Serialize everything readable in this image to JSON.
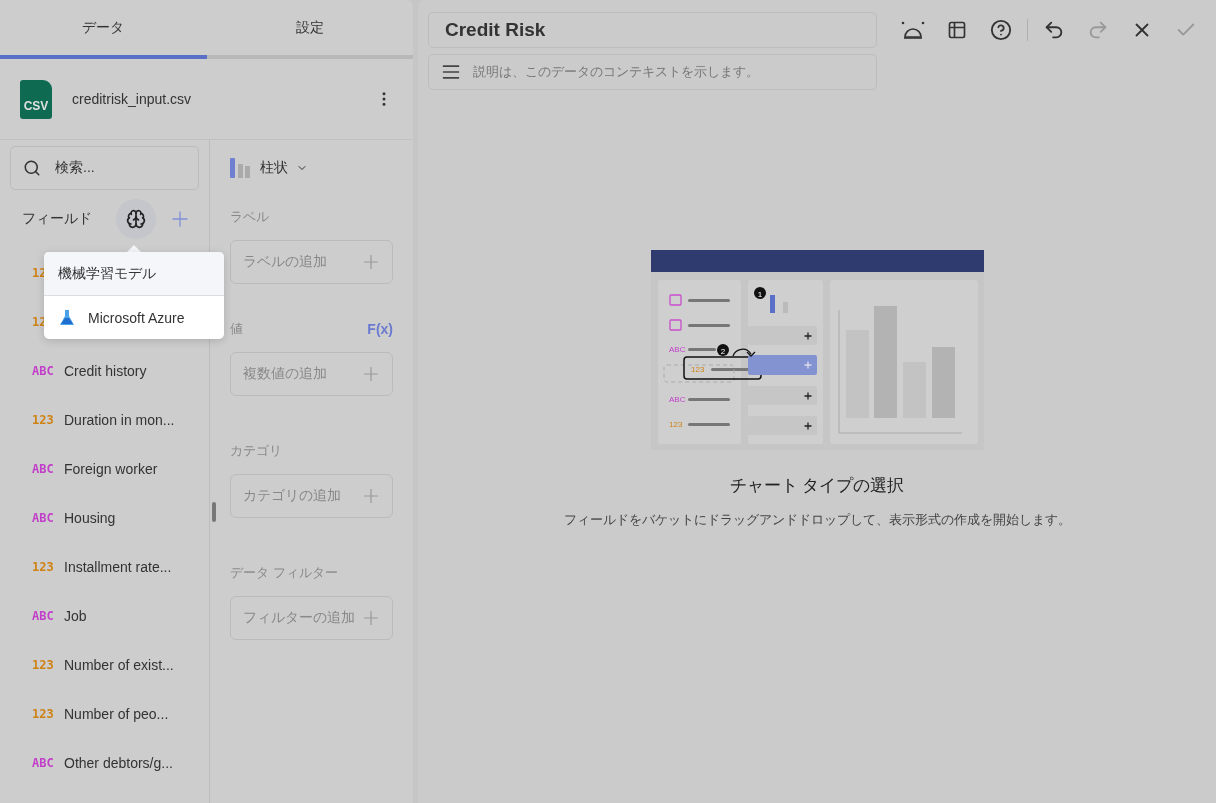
{
  "tabs": [
    {
      "label": "データ",
      "selected": true
    },
    {
      "label": "設定",
      "selected": false
    }
  ],
  "file": {
    "badge": "CSV",
    "name": "creditrisk_input.csv"
  },
  "search": {
    "placeholder": "検索..."
  },
  "fields_header": {
    "label": "フィールド"
  },
  "fields": [
    {
      "kind": "number",
      "type_label": "12"
    },
    {
      "kind": "number",
      "type_label": "12"
    },
    {
      "kind": "text",
      "type_label": "ABC",
      "label": "Credit history"
    },
    {
      "kind": "number",
      "type_label": "123",
      "label": "Duration in mon..."
    },
    {
      "kind": "text",
      "type_label": "ABC",
      "label": "Foreign worker"
    },
    {
      "kind": "text",
      "type_label": "ABC",
      "label": "Housing"
    },
    {
      "kind": "number",
      "type_label": "123",
      "label": "Installment rate..."
    },
    {
      "kind": "text",
      "type_label": "ABC",
      "label": "Job"
    },
    {
      "kind": "number",
      "type_label": "123",
      "label": "Number of exist..."
    },
    {
      "kind": "number",
      "type_label": "123",
      "label": "Number of peo..."
    },
    {
      "kind": "text",
      "type_label": "ABC",
      "label": "Other debtors/g..."
    }
  ],
  "popover": {
    "title": "機械学習モデル",
    "items": [
      {
        "label": "Microsoft Azure"
      }
    ]
  },
  "chart_type": {
    "label": "柱状"
  },
  "buckets": [
    {
      "title": "ラベル",
      "placeholder": "ラベルの追加"
    },
    {
      "title": "値",
      "action": "F(x)",
      "placeholder": "複数値の追加"
    },
    {
      "title": "カテゴリ",
      "placeholder": "カテゴリの追加"
    },
    {
      "title": "データ フィルター",
      "placeholder": "フィルターの追加"
    }
  ],
  "editor": {
    "title": "Credit Risk",
    "description_placeholder": "説明は、このデータのコンテキストを示します。"
  },
  "illustration": {
    "field_types": [
      "ABC",
      "123",
      "ABC",
      "123"
    ],
    "steps": [
      "1",
      "2"
    ]
  },
  "empty_state": {
    "title": "チャート タイプの選択",
    "message": "フィールドをバケットにドラッグアンドドロップして、表示形式の作成を開始します。"
  }
}
